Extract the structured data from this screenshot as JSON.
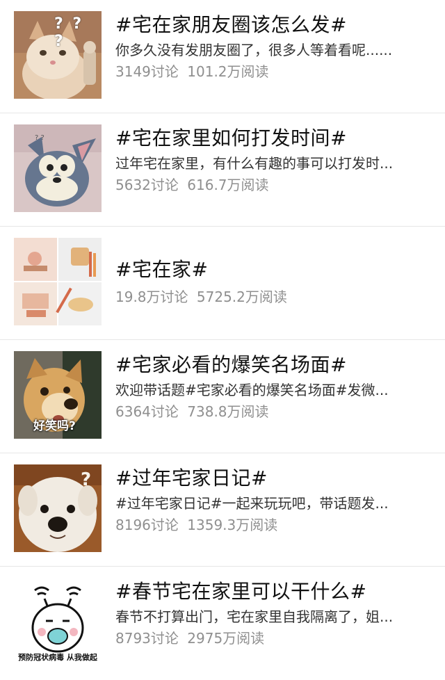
{
  "topics": [
    {
      "title": "#宅在家朋友圈该怎么发#",
      "description": "你多久没有发朋友圈了，很多人等着看呢......",
      "discussions": "3149讨论",
      "reads": "101.2万阅读",
      "thumb_icon": "confused-cat-icon",
      "thumb_text": "? ? ?"
    },
    {
      "title": "#宅在家里如何打发时间#",
      "description": "过年宅在家里，有什么有趣的事可以打发时...",
      "discussions": "5632讨论",
      "reads": "616.7万阅读",
      "thumb_icon": "cartoon-cat-icon"
    },
    {
      "title": "#宅在家#",
      "description": "",
      "discussions": "19.8万讨论",
      "reads": "5725.2万阅读",
      "thumb_icon": "home-illustrations-collage-icon"
    },
    {
      "title": "#宅家必看的爆笑名场面#",
      "description": "欢迎带话题#宅家必看的爆笑名场面#发微...",
      "discussions": "6364讨论",
      "reads": "738.8万阅读",
      "thumb_icon": "surprised-dog-icon",
      "thumb_text": "好笑吗?"
    },
    {
      "title": "#过年宅家日记#",
      "description": "#过年宅家日记#一起来玩玩吧，带话题发...",
      "discussions": "8196讨论",
      "reads": "1359.3万阅读",
      "thumb_icon": "white-puppy-icon"
    },
    {
      "title": "#春节宅在家里可以干什么#",
      "description": "春节不打算出门，宅在家里自我隔离了，姐...",
      "discussions": "8793讨论",
      "reads": "2975万阅读",
      "thumb_icon": "masked-character-icon",
      "thumb_text": "预防冠状病毒 从我做起"
    }
  ]
}
